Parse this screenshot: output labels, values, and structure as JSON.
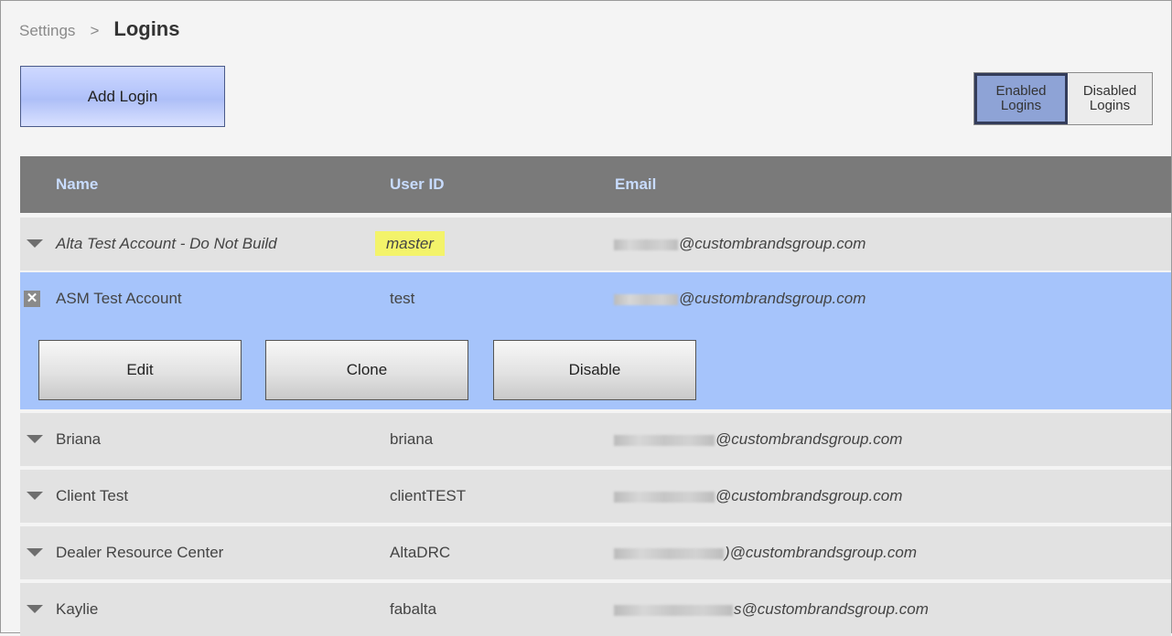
{
  "breadcrumb": {
    "parent": "Settings",
    "separator": ">",
    "current": "Logins"
  },
  "toolbar": {
    "add_label": "Add Login"
  },
  "toggle": {
    "enabled_label": "Enabled Logins",
    "disabled_label": "Disabled Logins",
    "active": "enabled"
  },
  "table": {
    "headers": [
      "Name",
      "User ID",
      "Email"
    ],
    "email_domain": "@custombrandsgroup.com",
    "rows": [
      {
        "name": "Alta Test Account - Do Not Build",
        "user_id": "master",
        "email_visible": "@custombrandsgroup.com",
        "style": "italic",
        "user_id_highlight": true
      },
      {
        "name": "ASM Test Account",
        "user_id": "test",
        "email_visible": "@custombrandsgroup.com",
        "selected": true
      },
      {
        "name": "Briana",
        "user_id": "briana",
        "email_visible": "@custombrandsgroup.com"
      },
      {
        "name": "Client Test",
        "user_id": "clientTEST",
        "email_visible": "@custombrandsgroup.com"
      },
      {
        "name": "Dealer Resource Center",
        "user_id": "AltaDRC",
        "email_visible": "@custombrandsgroup.com",
        "email_prefix_tail": ")"
      },
      {
        "name": "Kaylie",
        "user_id": "fabalta",
        "email_visible": "@custombrandsgroup.com",
        "email_prefix_tail": "s"
      }
    ]
  },
  "row_actions": {
    "edit_label": "Edit",
    "clone_label": "Clone",
    "disable_label": "Disable"
  },
  "icons": {
    "expand": "triangle-down-icon",
    "collapse": "close-x-icon"
  },
  "colors": {
    "header_bg": "#7a7a7a",
    "header_text": "#c8dcff",
    "selected_row": "#a6c4fb",
    "highlight": "#f3f36a"
  }
}
